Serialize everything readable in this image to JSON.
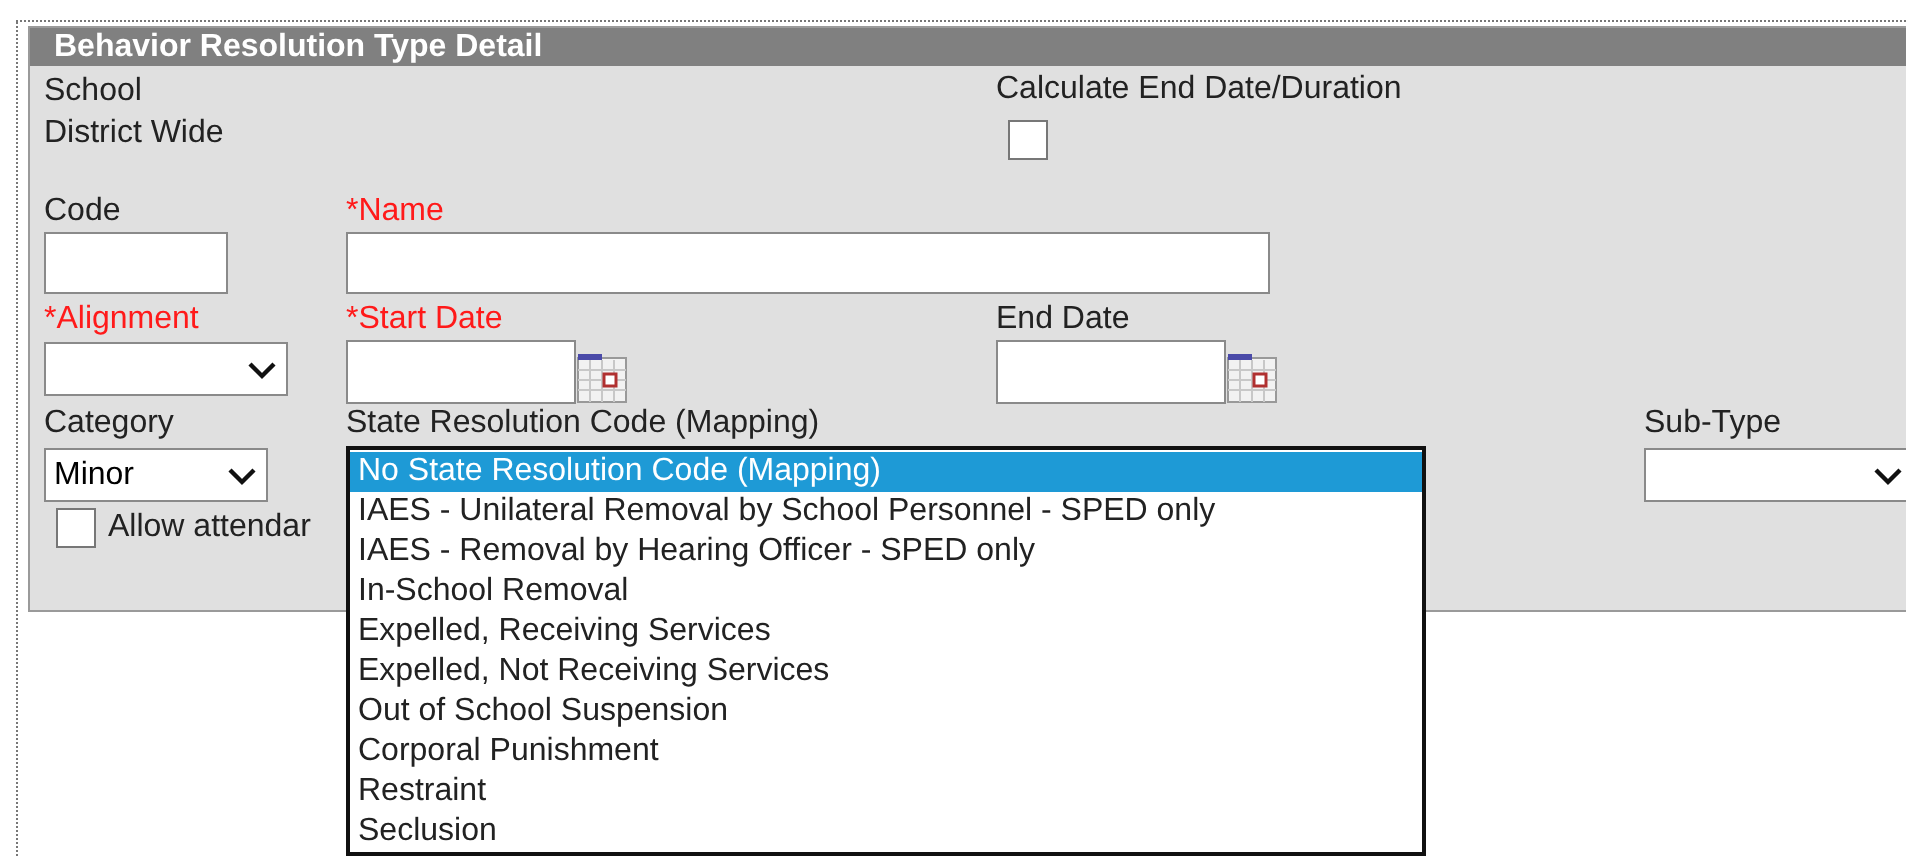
{
  "panel": {
    "title": "Behavior Resolution Type Detail"
  },
  "scope": [
    "School",
    "District Wide"
  ],
  "calculate_end_date": {
    "label": "Calculate End Date/Duration",
    "checked": false
  },
  "code": {
    "label": "Code",
    "required": false
  },
  "name": {
    "label": "*Name",
    "required": true
  },
  "alignment": {
    "label": "*Alignment",
    "required": true
  },
  "start_date": {
    "label": "*Start Date",
    "required": true
  },
  "end_date": {
    "label": "End Date",
    "required": false
  },
  "category": {
    "label": "Category",
    "value": "Minor"
  },
  "state_resolution_code": {
    "label": "State Resolution Code (Mapping)",
    "expanded": true,
    "options": [
      {
        "label": "No State Resolution Code (Mapping)",
        "selected": true
      },
      {
        "label": "IAES - Unilateral Removal by School Personnel - SPED only",
        "selected": false
      },
      {
        "label": "IAES - Removal by Hearing Officer - SPED only",
        "selected": false
      },
      {
        "label": "In-School Removal",
        "selected": false
      },
      {
        "label": "Expelled, Receiving Services",
        "selected": false
      },
      {
        "label": "Expelled, Not Receiving Services",
        "selected": false
      },
      {
        "label": "Out of School Suspension",
        "selected": false
      },
      {
        "label": "Corporal Punishment",
        "selected": false
      },
      {
        "label": "Restraint",
        "selected": false
      },
      {
        "label": "Seclusion",
        "selected": false
      }
    ]
  },
  "sub_type": {
    "label": "Sub-Type"
  },
  "allow_attendance": {
    "label": "Allow attendar",
    "checked": false
  }
}
